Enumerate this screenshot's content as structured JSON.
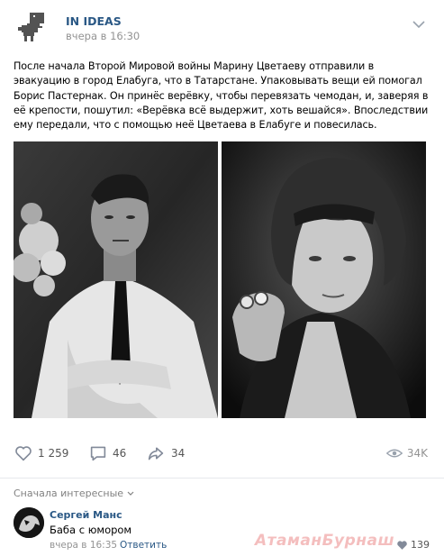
{
  "header": {
    "group_name": "IN IDEAS",
    "time": "вчера в 16:30",
    "avatar_icon": "dinosaur-icon",
    "more_icon": "chevron-down-icon"
  },
  "post": {
    "text": "После начала Второй Мировой войны Марину Цветаеву отправили в эвакуацию в город Елабуга, что в Татарстане. Упаковывать вещи ей помогал Борис Пастернак. Он принёс верёвку, чтобы перевязать чемодан, и, заверяя в её крепости, пошутил: «Верёвка всё выдержит, хоть вешайся». Впоследствии ему передали, что с помощью неё Цветаева в Елабуге и повесилась.",
    "photos": [
      "photo-portrait-man",
      "photo-portrait-woman"
    ]
  },
  "actions": {
    "likes": "1 259",
    "comments": "46",
    "shares": "34",
    "views": "34K",
    "like_icon": "heart-icon",
    "comment_icon": "comment-icon",
    "share_icon": "share-icon",
    "views_icon": "eye-icon"
  },
  "comments": {
    "sort_label": "Сначала интересные",
    "items": [
      {
        "author": "Сергей Манс",
        "text": "Баба с юмором",
        "time": "вчера в 16:35",
        "reply_label": "Ответить",
        "likes": "139"
      }
    ]
  },
  "watermark": "АтаманБурнаш",
  "colors": {
    "link": "#2a5885",
    "muted": "#939393",
    "divider": "#e7e8ec"
  }
}
